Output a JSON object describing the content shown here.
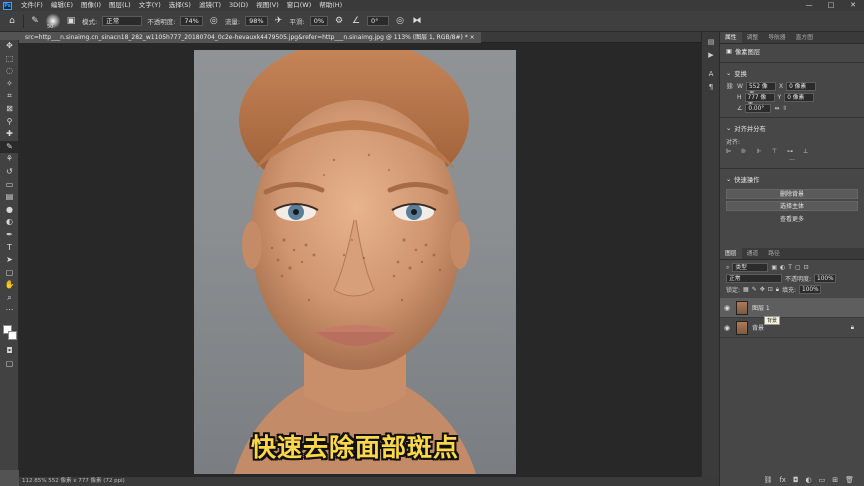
{
  "menubar": {
    "logo": "Ps",
    "items": [
      "文件(F)",
      "编辑(E)",
      "图像(I)",
      "图层(L)",
      "文字(Y)",
      "选择(S)",
      "滤镜(T)",
      "3D(D)",
      "视图(V)",
      "窗口(W)",
      "帮助(H)"
    ],
    "win_controls": [
      "—",
      "□",
      "✕"
    ]
  },
  "options": {
    "brush_size": "50",
    "mode_label": "模式:",
    "mode_value": "正常",
    "opacity_label": "不透明度:",
    "opacity_value": "74%",
    "flow_label": "流量:",
    "flow_value": "98%",
    "smoothing_label": "平滑:",
    "smoothing_value": "0%",
    "angle_value": "0°"
  },
  "document": {
    "tab_title": "src=http___n.sinaimg.cn_sinacn18_282_w1105h777_20180704_0c2e-hevauxk4479505.jpg&refer=http___n.sinaimg.jpg @ 113% (图层 1, RGB/8#) *",
    "tab_close": "×",
    "subtitle": "快速去除面部斑点"
  },
  "statusbar": {
    "text": "112.85%    552 像素 x 777 像素 (72 ppi)"
  },
  "properties_panel": {
    "tabs": [
      "属性",
      "调整",
      "导航器",
      "直方图"
    ],
    "layer_type": "像素图层",
    "transform_title": "变换",
    "w_label": "W",
    "w_value": "552 像素",
    "h_label": "H",
    "h_value": "777 像素",
    "x_label": "X",
    "x_value": "0 像素",
    "y_label": "Y",
    "y_value": "0 像素",
    "angle_value": "0.00°",
    "align_title": "对齐并分布",
    "align_label": "对齐:",
    "more": "···",
    "quick_title": "快速操作",
    "btn_remove_bg": "删除背景",
    "btn_select_subject": "选择主体",
    "link_more": "查看更多"
  },
  "layers_panel": {
    "tabs": [
      "图层",
      "通道",
      "路径"
    ],
    "filter_label": "类型",
    "blend_mode": "正常",
    "opacity_label": "不透明度:",
    "opacity_value": "100%",
    "lock_label": "锁定:",
    "fill_label": "填充:",
    "fill_value": "100%",
    "layers": [
      {
        "name": "图层 1",
        "selected": true
      },
      {
        "name": "背景",
        "selected": false
      }
    ],
    "tooltip": "背景"
  }
}
